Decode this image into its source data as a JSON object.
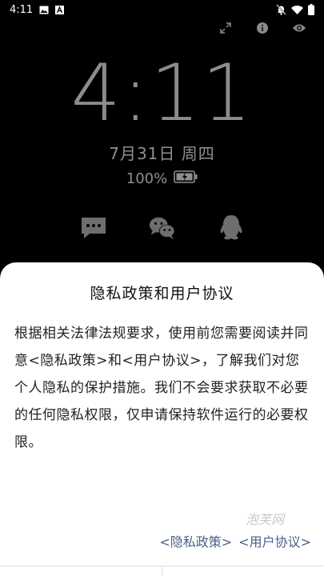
{
  "status_bar": {
    "time": "4:11",
    "icons": [
      "gallery-icon",
      "a-icon",
      "mute-bell-icon",
      "wifi-icon",
      "battery-icon"
    ]
  },
  "top_actions": [
    "expand-icon",
    "info-icon",
    "eye-icon"
  ],
  "lockscreen": {
    "clock": "4:11",
    "date": "7月31日 周四",
    "battery_percent": "100%"
  },
  "apps": [
    "messages-icon",
    "wechat-icon",
    "qq-icon"
  ],
  "dialog": {
    "title": "隐私政策和用户协议",
    "body": "根据相关法律法规要求，使用前您需要阅读并同意<隐私政策>和<用户协议>，了解我们对您个人隐私的保护措施。我们不会要求获取不必要的任何隐私权限，仅申请保持软件运行的必要权限。",
    "watermark": "泡芙网",
    "privacy_link": "<隐私政策>",
    "terms_link": "<用户协议>"
  },
  "colors": {
    "link": "#4d5f87",
    "clock": "#8c8c8c"
  }
}
